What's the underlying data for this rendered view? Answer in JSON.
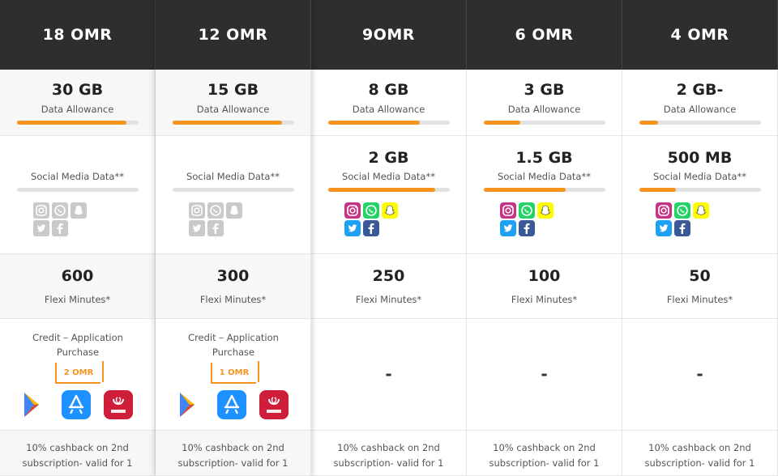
{
  "plans": [
    {
      "price": "18 OMR",
      "data_amount": "30 GB",
      "data_label": "Data Allowance",
      "data_fill": 0.9,
      "social_amount": "",
      "social_label": "Social Media Data**",
      "social_fill": 0,
      "social_icons_style": "gray",
      "minutes": "600",
      "minutes_label": "Flexi Minutes*",
      "credit_title": "Credit – Application Purchase",
      "credit_value": "2 OMR",
      "cashback_line1": "10% cashback on 2nd",
      "cashback_line2": "subscription- valid for 1"
    },
    {
      "price": "12 OMR",
      "data_amount": "15 GB",
      "data_label": "Data Allowance",
      "data_fill": 0.9,
      "social_amount": "",
      "social_label": "Social Media Data**",
      "social_fill": 0,
      "social_icons_style": "gray",
      "minutes": "300",
      "minutes_label": "Flexi Minutes*",
      "credit_title": "Credit – Application Purchase",
      "credit_value": "1 OMR",
      "cashback_line1": "10% cashback on 2nd",
      "cashback_line2": "subscription- valid for 1"
    },
    {
      "price": "9OMR",
      "data_amount": "8 GB",
      "data_label": "Data Allowance",
      "data_fill": 0.75,
      "social_amount": "2 GB",
      "social_label": "Social Media Data**",
      "social_fill": 0.88,
      "social_icons_style": "color",
      "minutes": "250",
      "minutes_label": "Flexi Minutes*",
      "credit_dash": "-",
      "cashback_line1": "10% cashback on 2nd",
      "cashback_line2": "subscription- valid for 1"
    },
    {
      "price": "6 OMR",
      "data_amount": "3 GB",
      "data_label": "Data Allowance",
      "data_fill": 0.3,
      "social_amount": "1.5 GB",
      "social_label": "Social Media Data**",
      "social_fill": 0.67,
      "social_icons_style": "color",
      "minutes": "100",
      "minutes_label": "Flexi Minutes*",
      "credit_dash": "-",
      "cashback_line1": "10% cashback on 2nd",
      "cashback_line2": "subscription- valid for 1"
    },
    {
      "price": "4 OMR",
      "data_amount": "2 GB-",
      "data_label": "Data Allowance",
      "data_fill": 0.15,
      "social_amount": "500 MB",
      "social_label": "Social Media Data**",
      "social_fill": 0.3,
      "social_icons_style": "color",
      "minutes": "50",
      "minutes_label": "Flexi Minutes*",
      "credit_dash": "-",
      "cashback_line1": "10% cashback on 2nd",
      "cashback_line2": "subscription- valid for 1"
    }
  ],
  "social_icons": [
    "instagram-icon",
    "whatsapp-icon",
    "snapchat-icon",
    "twitter-icon",
    "facebook-icon"
  ],
  "app_icons": [
    "google-play-icon",
    "app-store-icon",
    "huawei-appgallery-icon"
  ],
  "colors": {
    "accent": "#f7941d",
    "header_bg": "#2e2e2e",
    "instagram": "#c13584",
    "whatsapp": "#25d366",
    "snapchat": "#fffc00",
    "twitter": "#1da1f2",
    "facebook": "#3b5998",
    "app_store": "#1e90ff",
    "huawei": "#cf1e3a"
  }
}
